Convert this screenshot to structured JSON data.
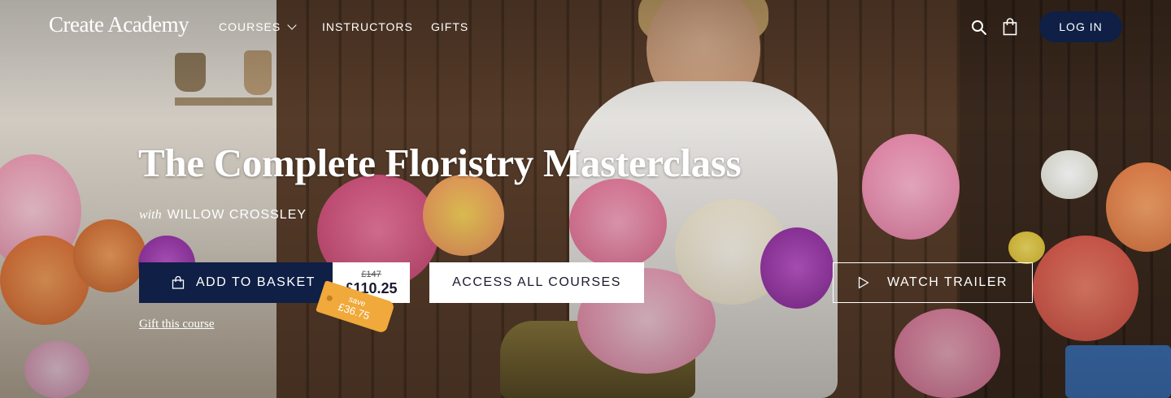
{
  "header": {
    "logo": "Create Academy",
    "nav": [
      {
        "label": "COURSES"
      },
      {
        "label": "INSTRUCTORS"
      },
      {
        "label": "GIFTS"
      }
    ],
    "login_label": "LOG IN"
  },
  "hero": {
    "title": "The Complete Floristry Masterclass",
    "byline_with": "with",
    "instructor": "WILLOW CROSSLEY",
    "add_to_basket_label": "ADD TO BASKET",
    "price_original": "£147",
    "price_current": "£110.25",
    "save_label": "save",
    "save_amount": "£36.75",
    "access_all_label": "ACCESS ALL COURSES",
    "watch_trailer_label": "WATCH TRAILER",
    "gift_link": "Gift this course"
  },
  "colors": {
    "navy": "#0f1f45",
    "save_tag": "#f0a93a",
    "white": "#ffffff"
  },
  "icons": [
    "chevron-down-icon",
    "search-icon",
    "shopping-bag-icon",
    "basket-icon",
    "play-icon"
  ]
}
